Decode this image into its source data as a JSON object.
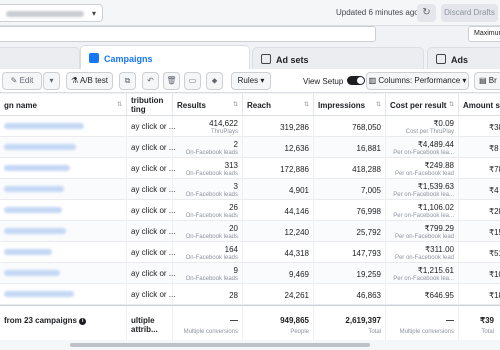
{
  "topbar": {
    "account_select_caret": "▾",
    "updated_text": "Updated 6 minutes ago",
    "refresh_icon": "↻",
    "discard_label": "Discard Drafts"
  },
  "search": {
    "maximize_label": "Maximun"
  },
  "tabs": [
    {
      "label": "Campaigns",
      "icon": "campaigns-icon",
      "active": true
    },
    {
      "label": "Ad sets",
      "icon": "adsets-icon",
      "active": false
    },
    {
      "label": "Ads",
      "icon": "ads-icon",
      "active": false
    }
  ],
  "toolbar": {
    "edit_label": "Edit",
    "ab_test_label": "A/B test",
    "rules_label": "Rules",
    "view_setup_label": "View Setup",
    "columns_label": "Columns: Performance",
    "breakdown_label": "Br"
  },
  "columns": {
    "name": "gn name",
    "attribution_line1": "tribution",
    "attribution_line2": "ting",
    "results": "Results",
    "reach": "Reach",
    "impressions": "Impressions",
    "cost_per_result": "Cost per result",
    "amount_spent": "Amount spe"
  },
  "rows": [
    {
      "attribution": "ay click or ...",
      "results": "414,622",
      "results_sub": "ThruPlays",
      "reach": "319,286",
      "impressions": "768,050",
      "cost": "₹0.09",
      "cost_sub": "Cost per ThruPlay",
      "amount": "₹38"
    },
    {
      "attribution": "ay click or ...",
      "results": "2",
      "results_sub": "On-Facebook leads",
      "reach": "12,636",
      "impressions": "16,881",
      "cost": "₹4,489.44",
      "cost_sub": "Per on-Facebook lea...",
      "amount": "₹8"
    },
    {
      "attribution": "ay click or ...",
      "results": "313",
      "results_sub": "On-Facebook leads",
      "reach": "172,886",
      "impressions": "418,288",
      "cost": "₹249.88",
      "cost_sub": "Per on-Facebook lead",
      "amount": "₹78"
    },
    {
      "attribution": "ay click or ...",
      "results": "3",
      "results_sub": "On-Facebook leads",
      "reach": "4,901",
      "impressions": "7,005",
      "cost": "₹1,539.63",
      "cost_sub": "Per on-Facebook lea...",
      "amount": "₹4"
    },
    {
      "attribution": "ay click or ...",
      "results": "26",
      "results_sub": "On-Facebook leads",
      "reach": "44,146",
      "impressions": "76,998",
      "cost": "₹1,106.02",
      "cost_sub": "Per on-Facebook lea...",
      "amount": "₹28"
    },
    {
      "attribution": "ay click or ...",
      "results": "20",
      "results_sub": "On-Facebook leads",
      "reach": "12,240",
      "impressions": "25,792",
      "cost": "₹799.29",
      "cost_sub": "Per on-Facebook lead",
      "amount": "₹15"
    },
    {
      "attribution": "ay click or ...",
      "results": "164",
      "results_sub": "On-Facebook leads",
      "reach": "44,318",
      "impressions": "147,793",
      "cost": "₹311.00",
      "cost_sub": "Per on-Facebook lead",
      "amount": "₹51"
    },
    {
      "attribution": "ay click or ...",
      "results": "9",
      "results_sub": "On-Facebook leads",
      "reach": "9,469",
      "impressions": "19,259",
      "cost": "₹1,215.61",
      "cost_sub": "Per on-Facebook lea...",
      "amount": "₹10"
    },
    {
      "attribution": "ay click or ...",
      "results": "28",
      "results_sub": "",
      "reach": "24,261",
      "impressions": "46,863",
      "cost": "₹646.95",
      "cost_sub": "",
      "amount": "₹18"
    }
  ],
  "totals": {
    "label": "from 23 campaigns",
    "attribution": "ultiple attrib...",
    "results": "—",
    "results_sub": "Multiple conversions",
    "reach": "949,865",
    "reach_sub": "People",
    "impressions": "2,619,397",
    "impressions_sub": "Total",
    "cost": "—",
    "cost_sub": "Multiple conversions",
    "amount": "₹39",
    "amount_sub": "Total"
  }
}
